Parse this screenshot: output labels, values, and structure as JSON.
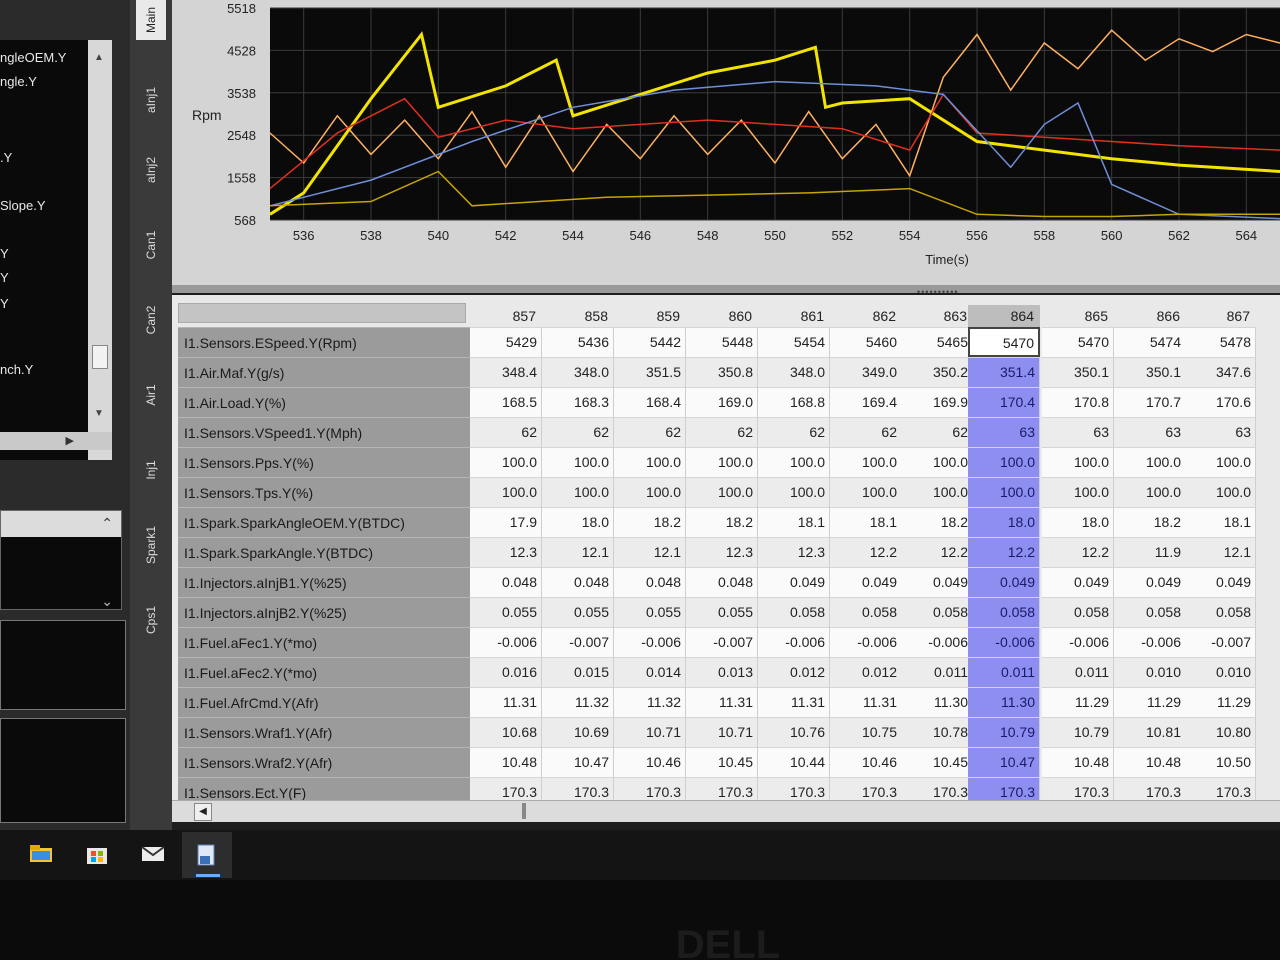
{
  "left_list": {
    "items": [
      "ngleOEM.Y",
      "ngle.Y",
      ".Y",
      "Slope.Y",
      "Y",
      "Y",
      "Y",
      "nch.Y"
    ]
  },
  "vertical_tabs": [
    "Main",
    "aInj1",
    "aInj2",
    "Can1",
    "Can2",
    "Air1",
    "Inj1",
    "Spark1",
    "Cps1"
  ],
  "chart_data": {
    "type": "line",
    "ylabel": "Rpm",
    "xlabel": "Time(s)",
    "y_ticks": [
      "5518",
      "4528",
      "3538",
      "2548",
      "1558",
      "568"
    ],
    "x_ticks": [
      "536",
      "538",
      "540",
      "542",
      "544",
      "546",
      "548",
      "550",
      "552",
      "554",
      "556",
      "558",
      "560",
      "562",
      "564"
    ],
    "ylim": [
      568,
      5518
    ],
    "xlim": [
      535,
      565
    ],
    "series": [
      {
        "color": "#f2e400",
        "x": [
          535,
          536,
          538,
          539.5,
          540,
          542,
          543.5,
          544,
          546,
          548,
          550,
          551.2,
          551.5,
          552,
          554,
          556,
          558,
          560,
          562,
          565
        ],
        "y": [
          700,
          1200,
          3400,
          4900,
          3200,
          3700,
          4300,
          3000,
          3500,
          4000,
          4300,
          4600,
          3200,
          3300,
          3400,
          2400,
          2200,
          2000,
          1850,
          1700
        ]
      },
      {
        "color": "#ffb060",
        "x": [
          535,
          536,
          537,
          538,
          539,
          540,
          541,
          542,
          543,
          544,
          545,
          546,
          547,
          548,
          549,
          550,
          551,
          552,
          553,
          554,
          555,
          556,
          557,
          558,
          559,
          560,
          561,
          562,
          563,
          564,
          565
        ],
        "y": [
          2600,
          1900,
          3000,
          2100,
          2900,
          2000,
          3100,
          1800,
          3000,
          1700,
          2800,
          2000,
          3000,
          2100,
          2900,
          1900,
          3100,
          2000,
          2800,
          1600,
          3900,
          4900,
          3600,
          4700,
          4100,
          5000,
          4300,
          4800,
          4500,
          4900,
          4700
        ]
      },
      {
        "color": "#e0301e",
        "x": [
          535,
          537,
          539,
          540,
          542,
          544,
          546,
          548,
          550,
          552,
          554,
          555,
          556,
          558,
          560,
          562,
          565
        ],
        "y": [
          1300,
          2600,
          3400,
          2500,
          2900,
          2700,
          2800,
          2900,
          2800,
          2700,
          2200,
          3500,
          2600,
          2500,
          2400,
          2300,
          2200
        ]
      },
      {
        "color": "#6f8fd8",
        "x": [
          535,
          538,
          541,
          544,
          547,
          550,
          553,
          555,
          557,
          558,
          559,
          560,
          562,
          565
        ],
        "y": [
          900,
          1500,
          2400,
          3200,
          3600,
          3800,
          3700,
          3500,
          1800,
          2800,
          3300,
          1400,
          700,
          600
        ]
      },
      {
        "color": "#c8a400",
        "x": [
          535,
          538,
          540,
          541,
          543,
          545,
          548,
          551,
          554,
          556,
          558,
          560,
          562,
          565
        ],
        "y": [
          900,
          1000,
          1700,
          900,
          1000,
          1100,
          1150,
          1200,
          1300,
          700,
          650,
          650,
          700,
          700
        ]
      }
    ]
  },
  "grid": {
    "columns": [
      "857",
      "858",
      "859",
      "860",
      "861",
      "862",
      "863",
      "864",
      "865",
      "866",
      "867"
    ],
    "selected_column": "864",
    "rows": [
      {
        "label": "I1.Sensors.ESpeed.Y(Rpm)",
        "values": [
          "5429",
          "5436",
          "5442",
          "5448",
          "5454",
          "5460",
          "5465",
          "5470",
          "5470",
          "5474",
          "5478"
        ]
      },
      {
        "label": "I1.Air.Maf.Y(g/s)",
        "values": [
          "348.4",
          "348.0",
          "351.5",
          "350.8",
          "348.0",
          "349.0",
          "350.2",
          "351.4",
          "350.1",
          "350.1",
          "347.6"
        ]
      },
      {
        "label": "I1.Air.Load.Y(%)",
        "values": [
          "168.5",
          "168.3",
          "168.4",
          "169.0",
          "168.8",
          "169.4",
          "169.9",
          "170.4",
          "170.8",
          "170.7",
          "170.6"
        ]
      },
      {
        "label": "I1.Sensors.VSpeed1.Y(Mph)",
        "values": [
          "62",
          "62",
          "62",
          "62",
          "62",
          "62",
          "62",
          "63",
          "63",
          "63",
          "63"
        ]
      },
      {
        "label": "I1.Sensors.Pps.Y(%)",
        "values": [
          "100.0",
          "100.0",
          "100.0",
          "100.0",
          "100.0",
          "100.0",
          "100.0",
          "100.0",
          "100.0",
          "100.0",
          "100.0"
        ]
      },
      {
        "label": "I1.Sensors.Tps.Y(%)",
        "values": [
          "100.0",
          "100.0",
          "100.0",
          "100.0",
          "100.0",
          "100.0",
          "100.0",
          "100.0",
          "100.0",
          "100.0",
          "100.0"
        ]
      },
      {
        "label": "I1.Spark.SparkAngleOEM.Y(BTDC)",
        "values": [
          "17.9",
          "18.0",
          "18.2",
          "18.2",
          "18.1",
          "18.1",
          "18.2",
          "18.0",
          "18.0",
          "18.2",
          "18.1"
        ]
      },
      {
        "label": "I1.Spark.SparkAngle.Y(BTDC)",
        "values": [
          "12.3",
          "12.1",
          "12.1",
          "12.3",
          "12.3",
          "12.2",
          "12.2",
          "12.2",
          "12.2",
          "11.9",
          "12.1"
        ]
      },
      {
        "label": "I1.Injectors.aInjB1.Y(%25)",
        "values": [
          "0.048",
          "0.048",
          "0.048",
          "0.048",
          "0.049",
          "0.049",
          "0.049",
          "0.049",
          "0.049",
          "0.049",
          "0.049"
        ]
      },
      {
        "label": "I1.Injectors.aInjB2.Y(%25)",
        "values": [
          "0.055",
          "0.055",
          "0.055",
          "0.055",
          "0.058",
          "0.058",
          "0.058",
          "0.058",
          "0.058",
          "0.058",
          "0.058"
        ]
      },
      {
        "label": "I1.Fuel.aFec1.Y(*mo)",
        "values": [
          "-0.006",
          "-0.007",
          "-0.006",
          "-0.007",
          "-0.006",
          "-0.006",
          "-0.006",
          "-0.006",
          "-0.006",
          "-0.006",
          "-0.007"
        ]
      },
      {
        "label": "I1.Fuel.aFec2.Y(*mo)",
        "values": [
          "0.016",
          "0.015",
          "0.014",
          "0.013",
          "0.012",
          "0.012",
          "0.011",
          "0.011",
          "0.011",
          "0.010",
          "0.010"
        ]
      },
      {
        "label": "I1.Fuel.AfrCmd.Y(Afr)",
        "values": [
          "11.31",
          "11.32",
          "11.32",
          "11.31",
          "11.31",
          "11.31",
          "11.30",
          "11.30",
          "11.29",
          "11.29",
          "11.29"
        ]
      },
      {
        "label": "I1.Sensors.Wraf1.Y(Afr)",
        "values": [
          "10.68",
          "10.69",
          "10.71",
          "10.71",
          "10.76",
          "10.75",
          "10.78",
          "10.79",
          "10.79",
          "10.81",
          "10.80"
        ]
      },
      {
        "label": "I1.Sensors.Wraf2.Y(Afr)",
        "values": [
          "10.48",
          "10.47",
          "10.46",
          "10.45",
          "10.44",
          "10.46",
          "10.45",
          "10.47",
          "10.48",
          "10.48",
          "10.50"
        ]
      },
      {
        "label": "I1.Sensors.Ect.Y(F)",
        "values": [
          "170.3",
          "170.3",
          "170.3",
          "170.3",
          "170.3",
          "170.3",
          "170.3",
          "170.3",
          "170.3",
          "170.3",
          "170.3"
        ]
      }
    ]
  },
  "taskbar": {
    "icons": [
      "file-explorer-icon",
      "store-icon",
      "mail-icon",
      "app-icon"
    ]
  },
  "bezel": {
    "brand": "DELL"
  }
}
